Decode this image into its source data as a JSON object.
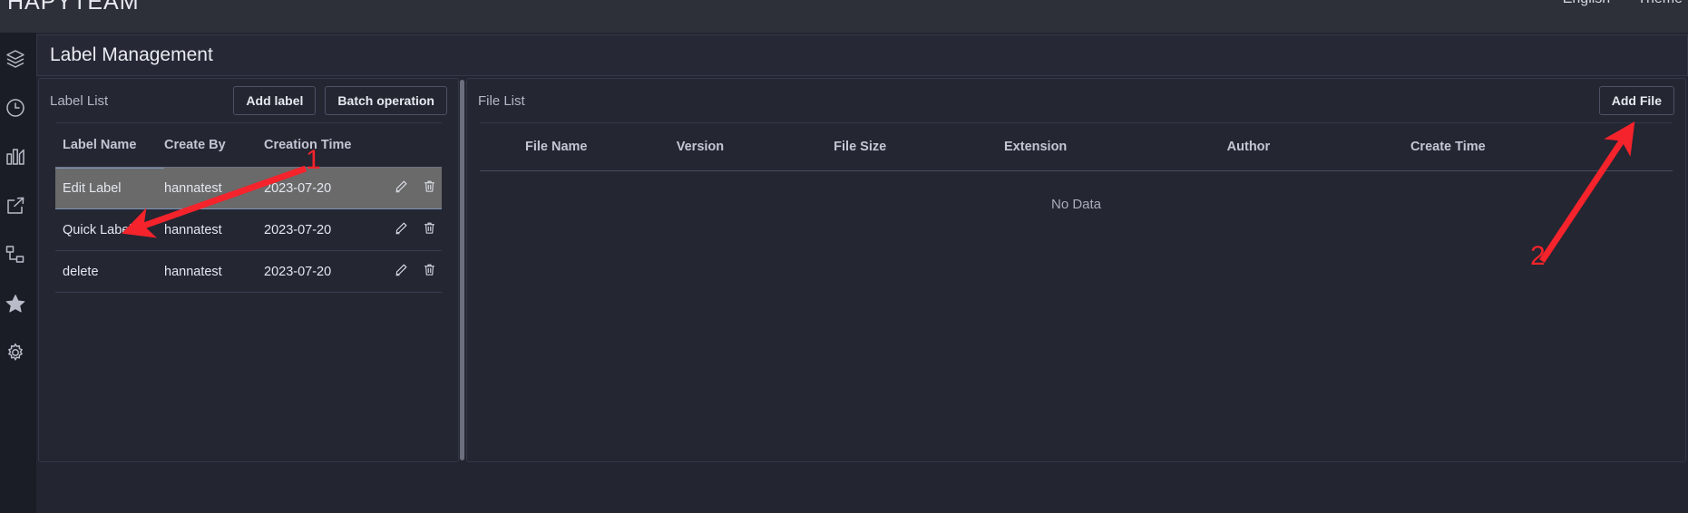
{
  "header": {
    "brand": "HAPYTEAM",
    "language": "English",
    "theme": "Theme"
  },
  "sidebar": {
    "items": [
      {
        "icon": "layers-icon",
        "name": "sidebar-item-layers"
      },
      {
        "icon": "clock-icon",
        "name": "sidebar-item-history"
      },
      {
        "icon": "bar-chart-icon",
        "name": "sidebar-item-statistics"
      },
      {
        "icon": "share-icon",
        "name": "sidebar-item-share"
      },
      {
        "icon": "sitemap-icon",
        "name": "sidebar-item-structure"
      },
      {
        "icon": "star-icon",
        "name": "sidebar-item-favorites"
      },
      {
        "icon": "gear-icon",
        "name": "sidebar-item-settings"
      }
    ]
  },
  "page": {
    "title": "Label Management"
  },
  "label_panel": {
    "title": "Label List",
    "add_label_button": "Add label",
    "batch_operation_button": "Batch operation",
    "columns": [
      "Label Name",
      "Create By",
      "Creation Time"
    ],
    "rows": [
      {
        "name": "Edit Label",
        "create_by": "hannatest",
        "creation_time": "2023-07-20",
        "selected": true
      },
      {
        "name": "Quick Label",
        "create_by": "hannatest",
        "creation_time": "2023-07-20",
        "selected": false
      },
      {
        "name": "delete",
        "create_by": "hannatest",
        "creation_time": "2023-07-20",
        "selected": false
      }
    ],
    "row_actions": [
      "edit-icon",
      "delete-icon"
    ]
  },
  "file_panel": {
    "title": "File List",
    "add_file_button": "Add File",
    "columns": [
      "File Name",
      "Version",
      "File Size",
      "Extension",
      "Author",
      "Create Time"
    ],
    "empty_text": "No Data"
  },
  "annotations": {
    "arrow_1_label": "1",
    "arrow_2_label": "2",
    "color": "#f5232b"
  },
  "colors": {
    "background": "#1b1d26",
    "panel": "#242632",
    "topbar": "#2e3039",
    "selected_row": "#6a6a6a",
    "annotation_red": "#f5232b"
  }
}
